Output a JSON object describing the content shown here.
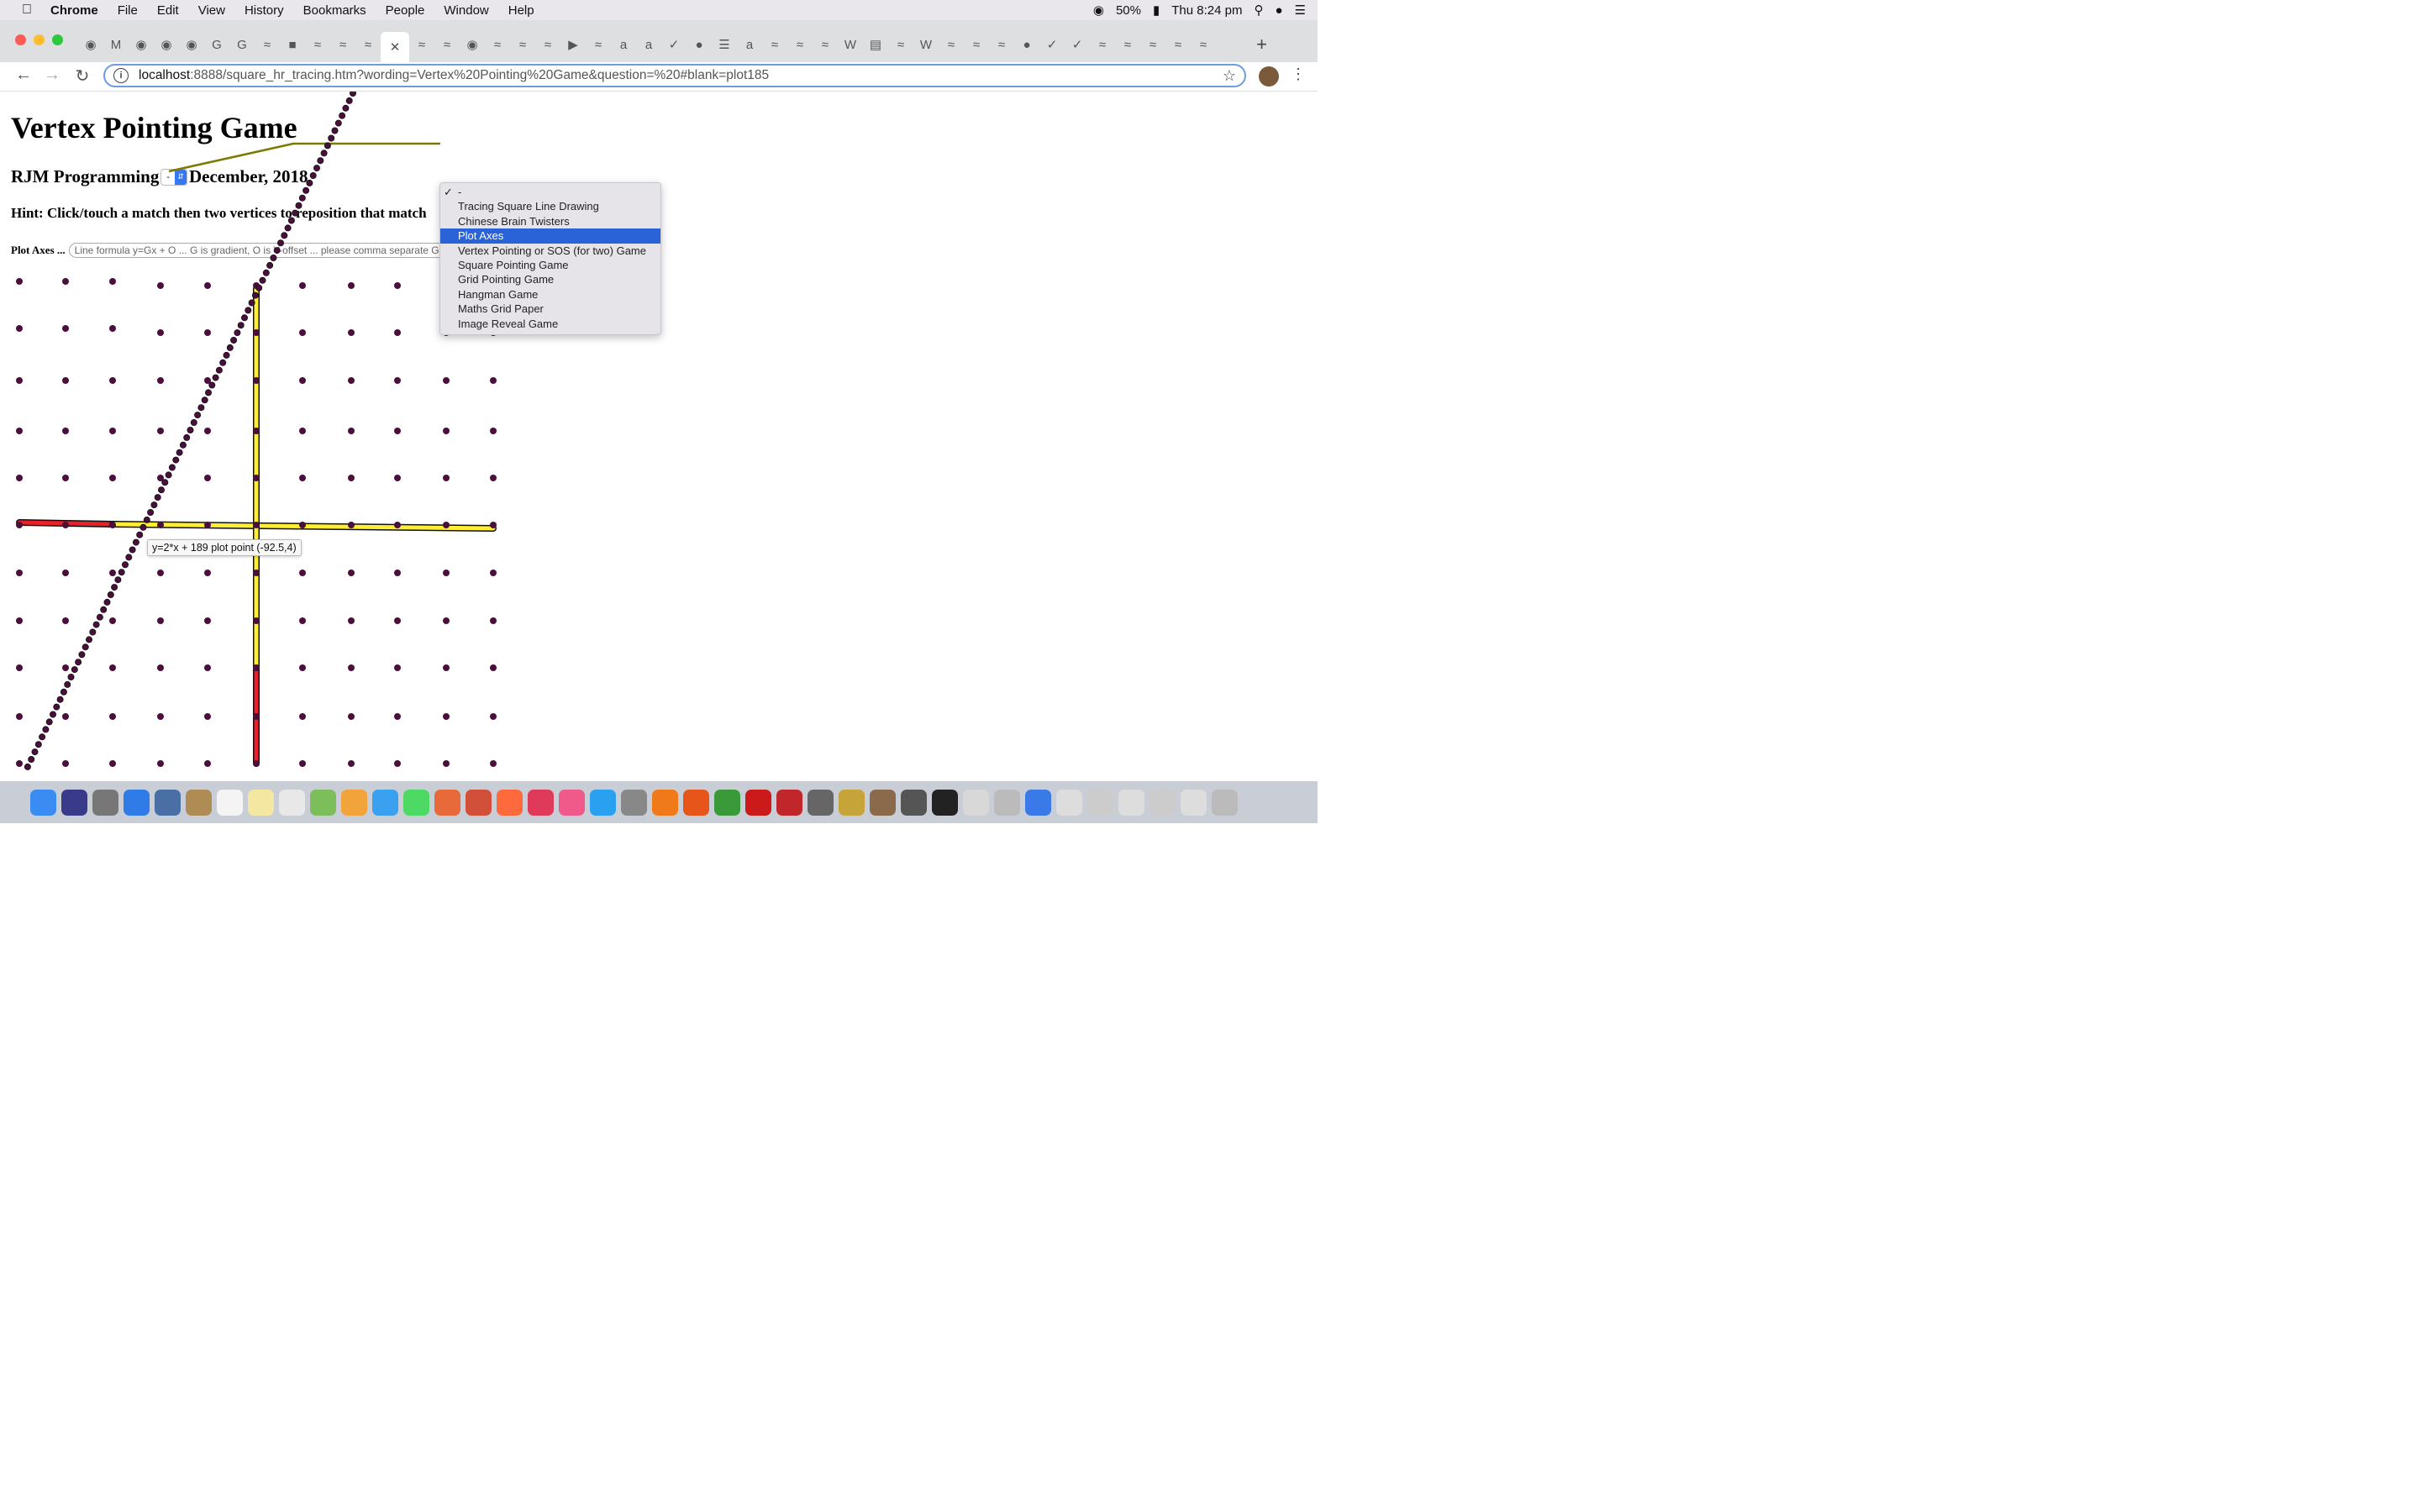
{
  "menubar": {
    "app": "Chrome",
    "items": [
      "File",
      "Edit",
      "View",
      "History",
      "Bookmarks",
      "People",
      "Window",
      "Help"
    ],
    "battery": "50%",
    "clock": "Thu 8:24 pm"
  },
  "browser": {
    "url_host": "localhost",
    "url_path": ":8888/square_hr_tracing.htm?wording=Vertex%20Pointing%20Game&question=%20#blank=plot185"
  },
  "page": {
    "title": "Vertex Pointing Game",
    "subtitle_left": "RJM Programming",
    "select_value": "-",
    "subtitle_right": "December, 2018",
    "hint": "Hint: Click/touch a match then two vertices to reposition that match",
    "plot_label": "Plot Axes ...",
    "formula_placeholder": "Line formula y=Gx + O ... G is gradient, O is Y-offset ... please comma separate G,O",
    "tooltip": "y=2*x + 189 plot point (-92.5,4)"
  },
  "dropdown": {
    "options": [
      {
        "label": "-",
        "checked": true
      },
      {
        "label": "Tracing Square Line Drawing"
      },
      {
        "label": "Chinese Brain Twisters"
      },
      {
        "label": "Plot Axes",
        "highlighted": true
      },
      {
        "label": "Vertex Pointing or SOS (for two) Game"
      },
      {
        "label": "Square Pointing Game"
      },
      {
        "label": "Grid Pointing Game"
      },
      {
        "label": "Hangman Game"
      },
      {
        "label": "Maths Grid Paper"
      },
      {
        "label": "Image Reveal Game"
      }
    ]
  },
  "colors": {
    "axis_yellow": "#ffee33",
    "axis_red": "#e8202a",
    "dot": "#4a0f3c",
    "connector": "#7a7a00",
    "highlight": "#2a62d8"
  }
}
